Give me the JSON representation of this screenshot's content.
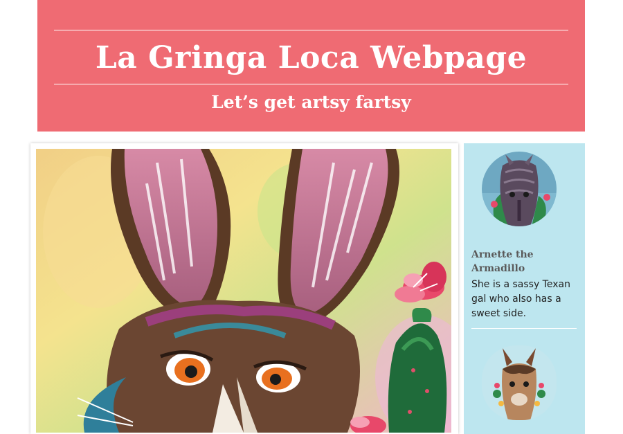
{
  "header": {
    "title": "La Gringa Loca Webpage",
    "tagline": "Let’s get artsy fartsy"
  },
  "featured_art": {
    "subject": "jackrabbit-with-prickly-pear-cactus-painting"
  },
  "sidebar": {
    "items": [
      {
        "name": "Arnette the Armadillo",
        "description": "She is a sassy Texan gal who also has a sweet side.",
        "avatar": "armadillo-painting"
      },
      {
        "avatar": "llama-painting"
      }
    ]
  },
  "colors": {
    "header_bg": "#ef6b73",
    "sidebar_bg": "#bde6ef",
    "header_text": "#ffffff"
  }
}
